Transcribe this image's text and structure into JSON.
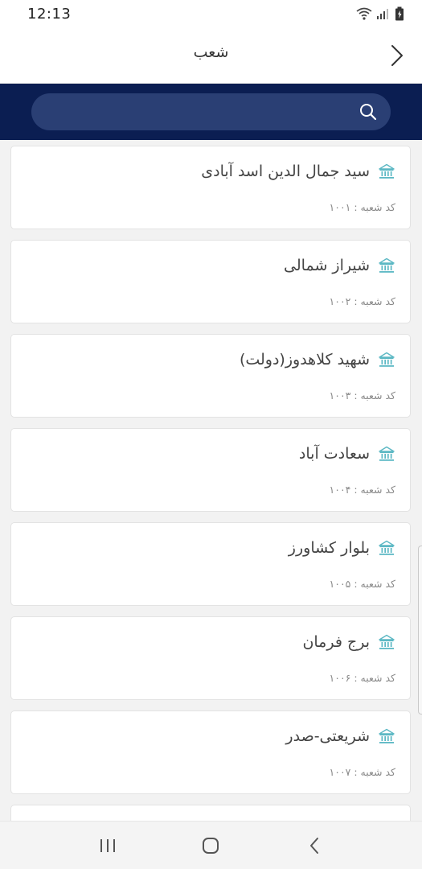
{
  "status_bar": {
    "time": "12:13"
  },
  "header": {
    "title": "شعب"
  },
  "search": {
    "placeholder": "",
    "value": ""
  },
  "branches": [
    {
      "name": "سید جمال الدین اسد آبادی",
      "code": "کد شعبه : ۱۰۰۱"
    },
    {
      "name": "شیراز شمالی",
      "code": "کد شعبه : ۱۰۰۲"
    },
    {
      "name": "شهید کلاهدوز(دولت)",
      "code": "کد شعبه : ۱۰۰۳"
    },
    {
      "name": "سعادت آباد",
      "code": "کد شعبه : ۱۰۰۴"
    },
    {
      "name": "بلوار کشاورز",
      "code": "کد شعبه : ۱۰۰۵"
    },
    {
      "name": "برج فرمان",
      "code": "کد شعبه : ۱۰۰۶"
    },
    {
      "name": "شریعتی-صدر",
      "code": "کد شعبه : ۱۰۰۷"
    }
  ],
  "colors": {
    "header_band": "#0b1e52",
    "search_field": "#2a3f74",
    "bank_icon": "#5cb8c4"
  },
  "icons": {
    "back": "chevron-right-icon",
    "search": "search-icon",
    "branch": "bank-icon",
    "nav_recents": "recents-icon",
    "nav_home": "home-icon",
    "nav_back": "back-icon"
  }
}
